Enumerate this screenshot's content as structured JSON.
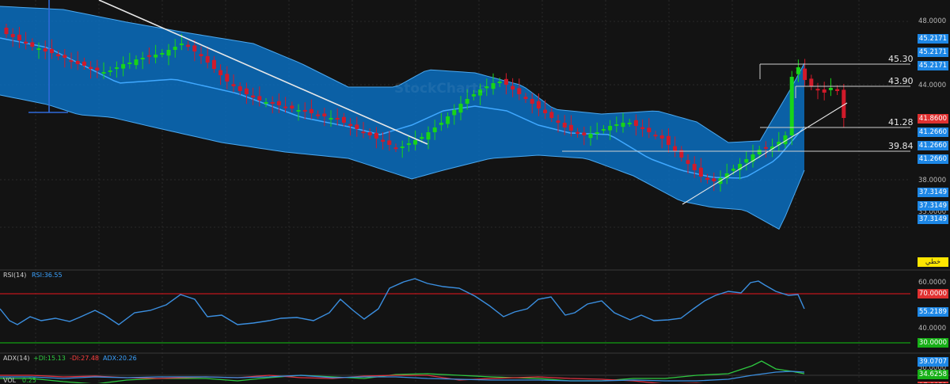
{
  "watermark": "StockCharts",
  "colors": {
    "up": "#18d418",
    "down": "#d11a2a",
    "band_fill": "#0a6ec0",
    "band_edge": "#4aa8f0",
    "middle_band": "#3fa8ff",
    "trendline": "#e8e8e8",
    "rsi_line": "#3b8fe0",
    "overbought_line": "#c0141c",
    "oversold_line": "#11a011",
    "plus_di": "#2ec840",
    "minus_di": "#e03040",
    "adx": "#3b8fe0",
    "tag_blue": "#1d87e6",
    "tag_red": "#e03030",
    "tag_green": "#17b017",
    "tag_yellow": "#ffe600"
  },
  "price_axis": {
    "ticks": [
      "48.0000",
      "44.0000",
      "38.0000",
      "35.0000"
    ],
    "tags_blue": [
      "45.2171",
      "45.2171",
      "45.2171",
      "41.2660",
      "41.2660",
      "41.2660",
      "37.3149",
      "37.3149",
      "37.3149"
    ],
    "last_price": "41.8600",
    "yellow_tag": "خطي"
  },
  "levels": [
    "45.30",
    "43.90",
    "41.28",
    "39.84"
  ],
  "rsi_panel": {
    "label": "RSI(14)",
    "value": "RSI:36.55",
    "ticks": [
      "60.0000",
      "40.0000"
    ],
    "tag_overbought": "70.0000",
    "tag_value": "55.2189",
    "tag_oversold": "30.0000"
  },
  "adx_panel": {
    "label": "ADX(14)",
    "plus_di": "+DI:15.13",
    "minus_di": "-DI:27.48",
    "adx": "ADX:20.26",
    "tag_1": "39.0707",
    "tag_2": "34.6258",
    "tag_3": "17.8853",
    "tick": "50.0000"
  },
  "vol_panel": {
    "label": "VOL",
    "value": "0.25"
  },
  "chart_data": {
    "type": "candlestick",
    "indicators": [
      "Bollinger Bands",
      "RSI(14)",
      "ADX(14)",
      "VOL"
    ],
    "price_axis_ticks": [
      48,
      44,
      38,
      35
    ],
    "price_levels": [
      45.3,
      43.9,
      41.28,
      39.84
    ],
    "last_price": 41.86,
    "bollinger": {
      "upper": 45.2171,
      "middle": 41.266,
      "lower": 37.3149
    },
    "rsi": {
      "value": 36.55,
      "overbought": 70,
      "oversold": 30,
      "tag": 55.2189
    },
    "adx": {
      "plus_di": 15.13,
      "minus_di": 27.48,
      "adx": 20.26
    },
    "vol": 0.25,
    "candle_count": 125,
    "candles_close": [
      47.2,
      47.0,
      46.8,
      46.6,
      46.4,
      46.3,
      46.1,
      46.0,
      45.8,
      45.7,
      45.5,
      45.3,
      45.2,
      45.0,
      44.9,
      44.8,
      44.9,
      45.1,
      45.3,
      45.4,
      45.6,
      45.7,
      45.8,
      45.9,
      46.0,
      46.2,
      46.4,
      46.6,
      46.4,
      46.1,
      45.8,
      45.4,
      45.0,
      44.6,
      44.2,
      43.9,
      43.6,
      43.4,
      43.2,
      43.0,
      42.9,
      42.8,
      42.7,
      42.6,
      42.5,
      42.4,
      42.3,
      42.2,
      42.1,
      42.0,
      41.9,
      41.8,
      41.6,
      41.4,
      41.2,
      41.0,
      40.8,
      40.6,
      40.4,
      40.2,
      40.0,
      40.1,
      40.3,
      40.5,
      40.7,
      41.0,
      41.3,
      41.6,
      42.0,
      42.4,
      42.8,
      43.1,
      43.4,
      43.7,
      43.9,
      44.1,
      44.2,
      44.0,
      43.7,
      43.4,
      43.1,
      42.8,
      42.5,
      42.2,
      41.9,
      41.6,
      41.3,
      41.1,
      40.9,
      40.8,
      40.9,
      41.0,
      41.2,
      41.4,
      41.5,
      41.6,
      41.6,
      41.4,
      41.2,
      41.0,
      40.8,
      40.6,
      40.2,
      39.8,
      39.4,
      39.0,
      38.6,
      38.2,
      38.0,
      37.9,
      38.1,
      38.4,
      38.7,
      39.0,
      39.3,
      39.6,
      39.9,
      40.0,
      40.1,
      40.4,
      40.8,
      44.5,
      45.1,
      44.3,
      43.9,
      43.7,
      43.5,
      43.8,
      43.6,
      41.9
    ]
  }
}
